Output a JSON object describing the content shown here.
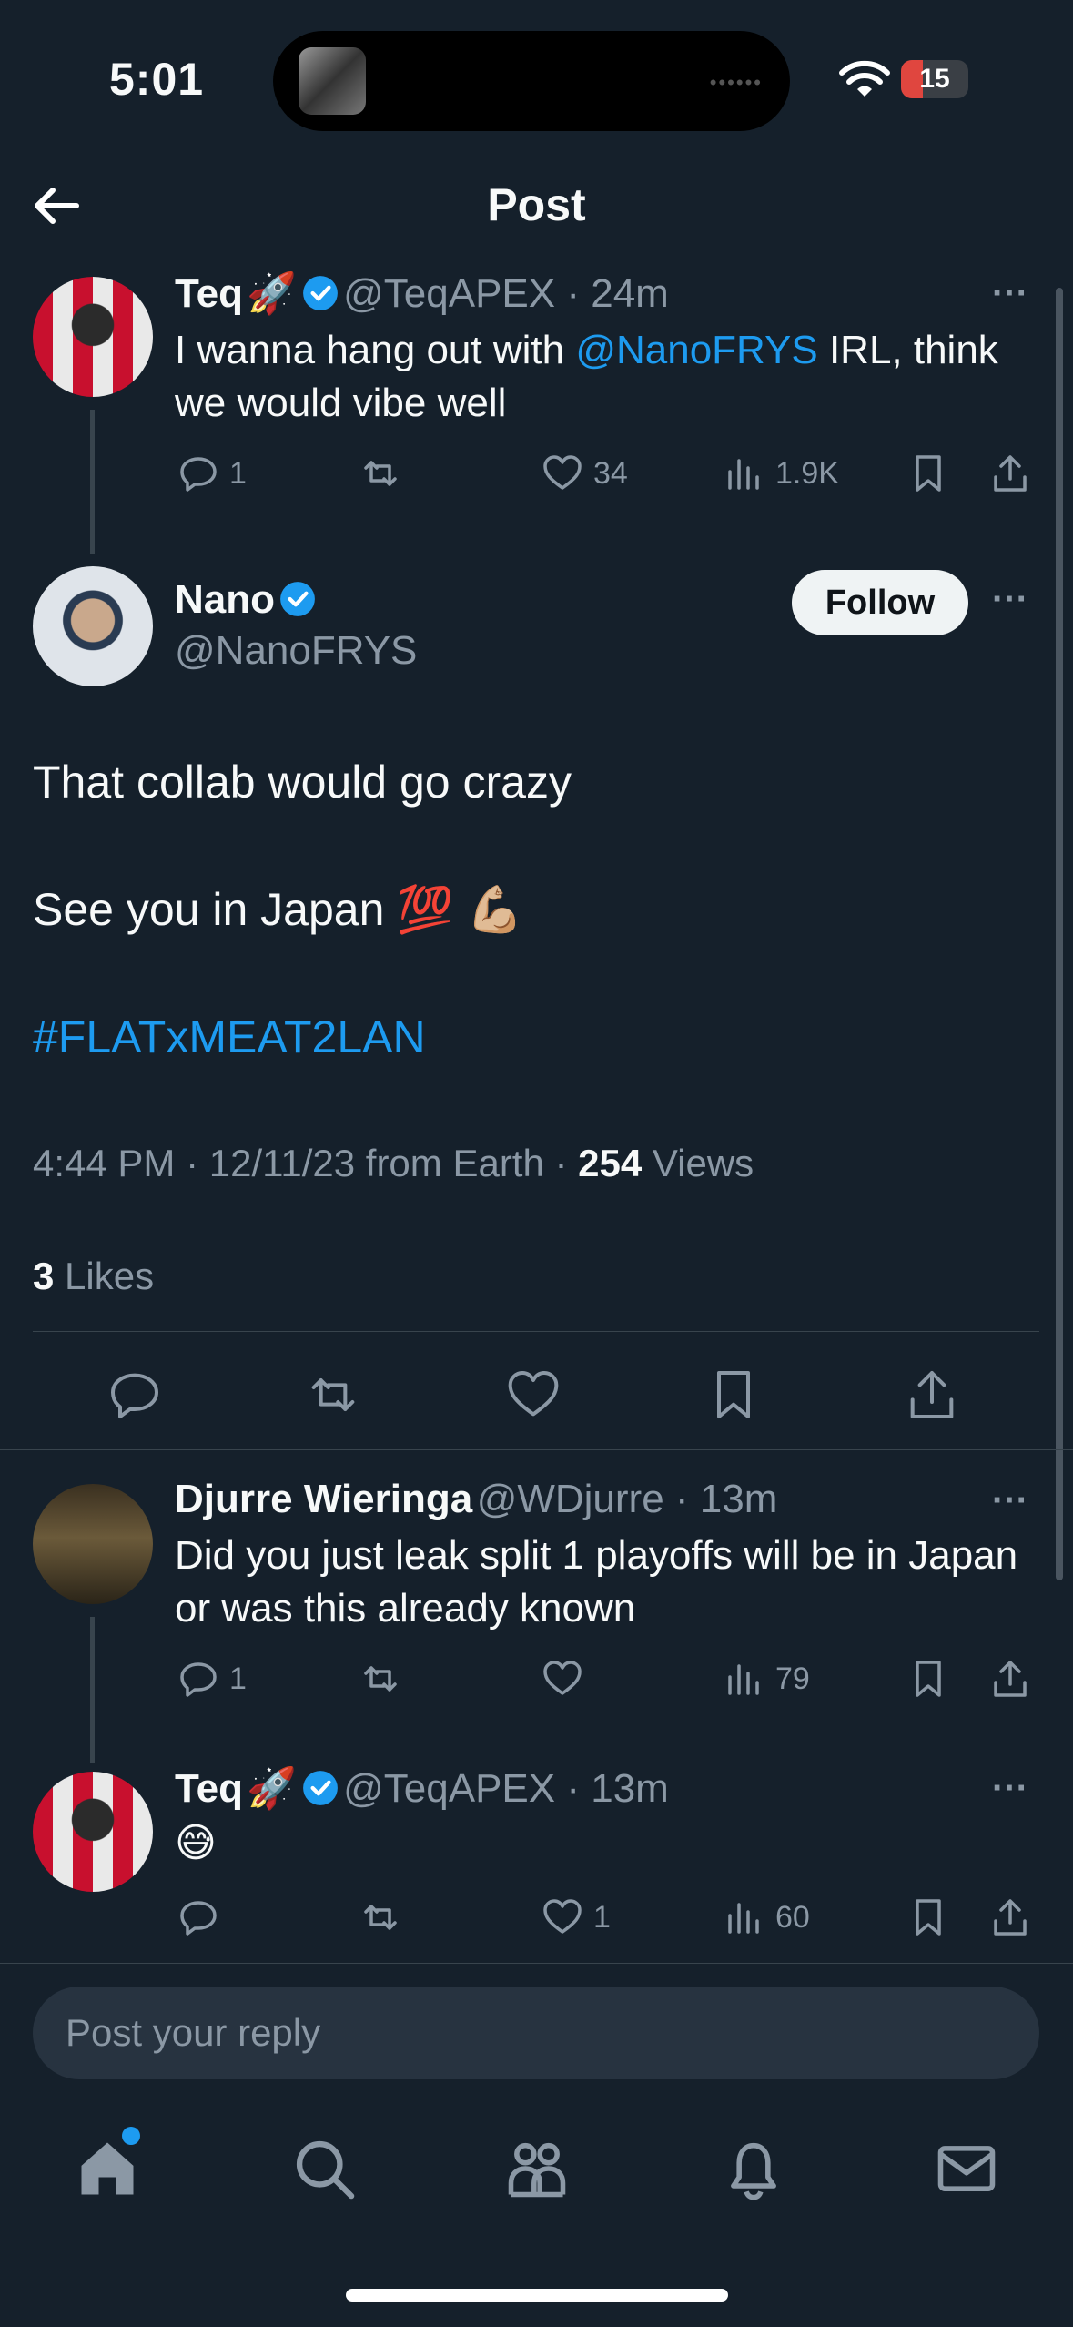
{
  "status": {
    "time": "5:01",
    "battery": "15"
  },
  "header": {
    "title": "Post"
  },
  "parent_tweet": {
    "name": "Teq",
    "name_emoji": "🚀",
    "handle": "@TeqAPEX",
    "time": "24m",
    "text_before": "I wanna hang out with ",
    "mention": "@NanoFRYS",
    "text_after": " IRL, think we would vibe well",
    "replies": "1",
    "likes": "34",
    "views": "1.9K"
  },
  "main_tweet": {
    "name": "Nano",
    "handle": "@NanoFRYS",
    "follow_label": "Follow",
    "line1": "That collab would go crazy",
    "line2": "See you in Japan 💯 💪🏼",
    "hashtag": "#FLATxMEAT2LAN",
    "meta": "4:44 PM · 12/11/23 from Earth · ",
    "views_count": "254",
    "views_label": " Views",
    "likes_count": "3",
    "likes_label": " Likes"
  },
  "reply1": {
    "name": "Djurre Wieringa",
    "handle": "@WDjurre",
    "time": "13m",
    "text": "Did you just leak split 1 playoffs will be in Japan or was this already known",
    "replies": "1",
    "views": "79"
  },
  "reply2": {
    "name": "Teq",
    "name_emoji": "🚀",
    "handle": "@TeqAPEX",
    "time": "13m",
    "text": "😅",
    "likes": "1",
    "views": "60"
  },
  "composer": {
    "placeholder": "Post your reply"
  },
  "nav": {
    "tabs": [
      "home-icon",
      "search-icon",
      "communities-icon",
      "notifications-icon",
      "messages-icon"
    ]
  },
  "colors": {
    "background": "#15202b",
    "accent": "#1d9bf0",
    "muted": "#8b98a5"
  }
}
